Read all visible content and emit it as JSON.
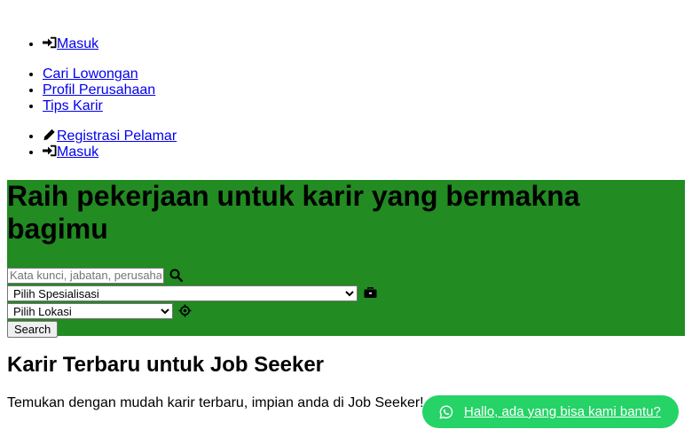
{
  "nav_top": {
    "login_label": "Masuk"
  },
  "nav_main": {
    "items": [
      {
        "label": "Cari Lowongan"
      },
      {
        "label": "Profil Perusahaan"
      },
      {
        "label": "Tips Karir"
      }
    ]
  },
  "nav_auth": {
    "register_label": "Registrasi Pelamar",
    "login_label": "Masuk"
  },
  "hero": {
    "title": "Raih pekerjaan untuk karir yang bermakna bagimu",
    "background_color": "#228b22"
  },
  "search_form": {
    "keyword_placeholder": "Kata kunci, jabatan, perusahaan",
    "keyword_value": "",
    "specialization_selected": "Pilih Spesialisasi",
    "location_selected": "Pilih Lokasi",
    "submit_label": "Search",
    "icons": {
      "keyword": "search-icon",
      "specialization": "briefcase-icon",
      "location": "crosshairs-icon"
    }
  },
  "section": {
    "title": "Karir Terbaru untuk Job Seeker",
    "description": "Temukan dengan mudah karir terbaru, impian anda di Job Seeker!"
  },
  "whatsapp_button": {
    "label": "Hallo, ada yang bisa kami bantu?",
    "icon": "whatsapp-icon",
    "color": "#25d366"
  }
}
